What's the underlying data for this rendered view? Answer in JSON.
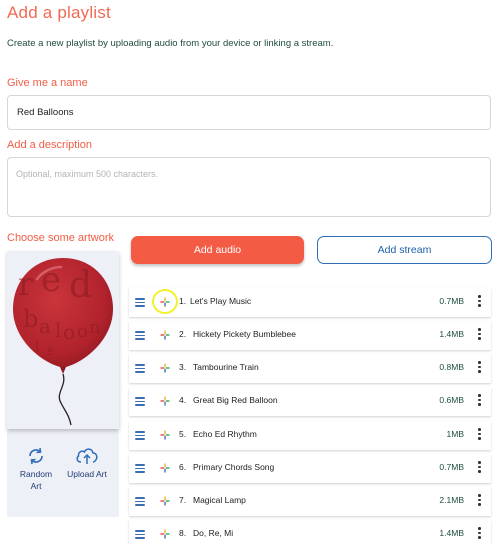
{
  "page": {
    "title": "Add a playlist",
    "subtitle": "Create a new playlist by uploading audio from your device or linking a stream."
  },
  "name_section": {
    "label": "Give me a name",
    "value": "Red Balloons"
  },
  "description_section": {
    "label": "Add a description",
    "placeholder": "Optional, maximum 500 characters."
  },
  "artwork_section": {
    "label": "Choose some artwork",
    "random_art_label": "Random\nArt",
    "upload_art_label": "Upload Art",
    "artwork_text": "red balloons"
  },
  "buttons": {
    "add_audio": "Add audio",
    "add_stream": "Add stream"
  },
  "tracks": [
    {
      "num": "1.",
      "title": "Let's Play Music",
      "size": "0.7MB"
    },
    {
      "num": "2.",
      "title": "Hickety Pickety Bumblebee",
      "size": "1.4MB"
    },
    {
      "num": "3.",
      "title": "Tambourine Train",
      "size": "0.8MB"
    },
    {
      "num": "4.",
      "title": "Great Big Red Balloon",
      "size": "0.6MB"
    },
    {
      "num": "5.",
      "title": "Echo Ed Rhythm",
      "size": "1MB"
    },
    {
      "num": "6.",
      "title": "Primary Chords Song",
      "size": "0.7MB"
    },
    {
      "num": "7.",
      "title": "Magical Lamp",
      "size": "2.1MB"
    },
    {
      "num": "8.",
      "title": "Do, Re, Mi",
      "size": "1.4MB"
    }
  ],
  "icons": {
    "drag": "drag-handle-icon",
    "track_badge": "sparkle-icon",
    "menu": "more-vertical-icon",
    "random": "refresh-icon",
    "upload": "cloud-upload-icon"
  },
  "colors": {
    "accent": "#f45b45",
    "heading": "#f06a55",
    "link_blue": "#1f5fa8",
    "balloon": "#b8252f"
  }
}
